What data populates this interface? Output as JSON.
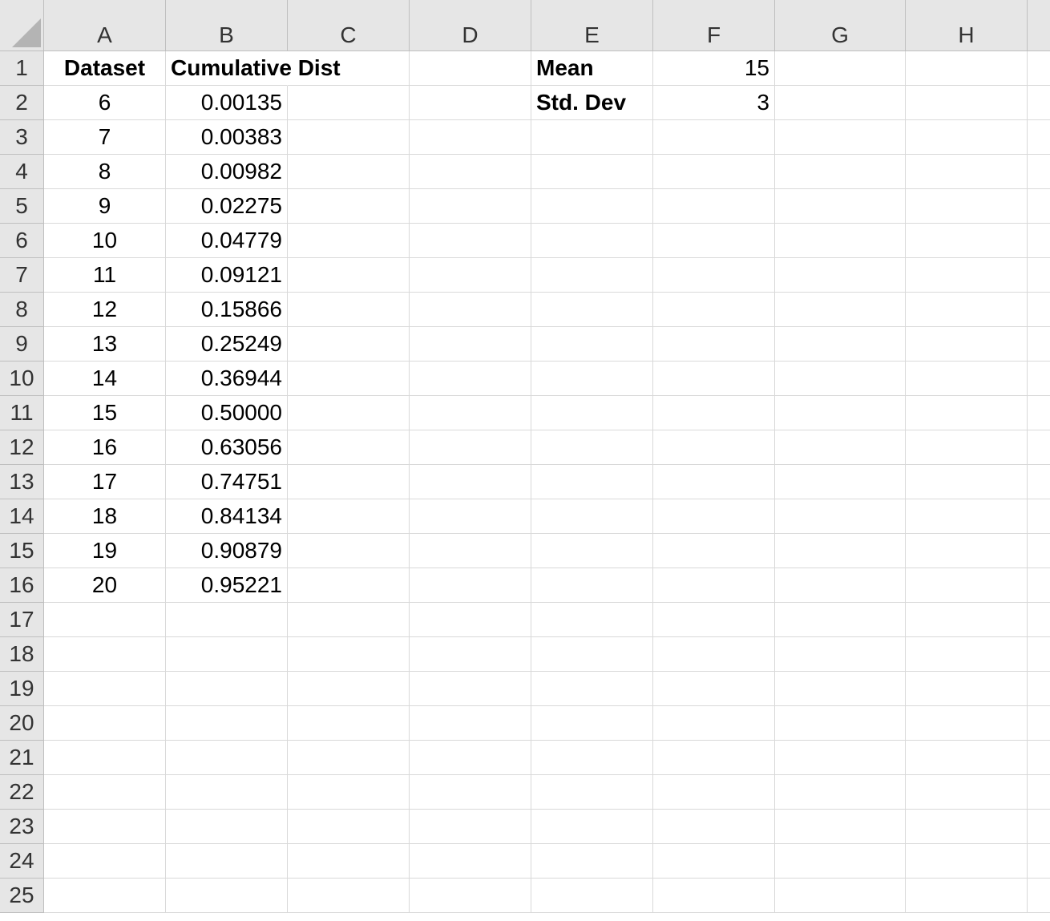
{
  "columns": [
    "A",
    "B",
    "C",
    "D",
    "E",
    "F",
    "G",
    "H"
  ],
  "rows": [
    "1",
    "2",
    "3",
    "4",
    "5",
    "6",
    "7",
    "8",
    "9",
    "10",
    "11",
    "12",
    "13",
    "14",
    "15",
    "16",
    "17",
    "18",
    "19",
    "20",
    "21",
    "22",
    "23",
    "24",
    "25"
  ],
  "headers": {
    "dataset": "Dataset",
    "cumulative_dist": "Cumulative Dist"
  },
  "params": {
    "mean_label": "Mean",
    "mean_value": "15",
    "sd_label": "Std. Dev",
    "sd_value": "3"
  },
  "table": [
    {
      "x": "6",
      "cdf": "0.00135"
    },
    {
      "x": "7",
      "cdf": "0.00383"
    },
    {
      "x": "8",
      "cdf": "0.00982"
    },
    {
      "x": "9",
      "cdf": "0.02275"
    },
    {
      "x": "10",
      "cdf": "0.04779"
    },
    {
      "x": "11",
      "cdf": "0.09121"
    },
    {
      "x": "12",
      "cdf": "0.15866"
    },
    {
      "x": "13",
      "cdf": "0.25249"
    },
    {
      "x": "14",
      "cdf": "0.36944"
    },
    {
      "x": "15",
      "cdf": "0.50000"
    },
    {
      "x": "16",
      "cdf": "0.63056"
    },
    {
      "x": "17",
      "cdf": "0.74751"
    },
    {
      "x": "18",
      "cdf": "0.84134"
    },
    {
      "x": "19",
      "cdf": "0.90879"
    },
    {
      "x": "20",
      "cdf": "0.95221"
    }
  ]
}
